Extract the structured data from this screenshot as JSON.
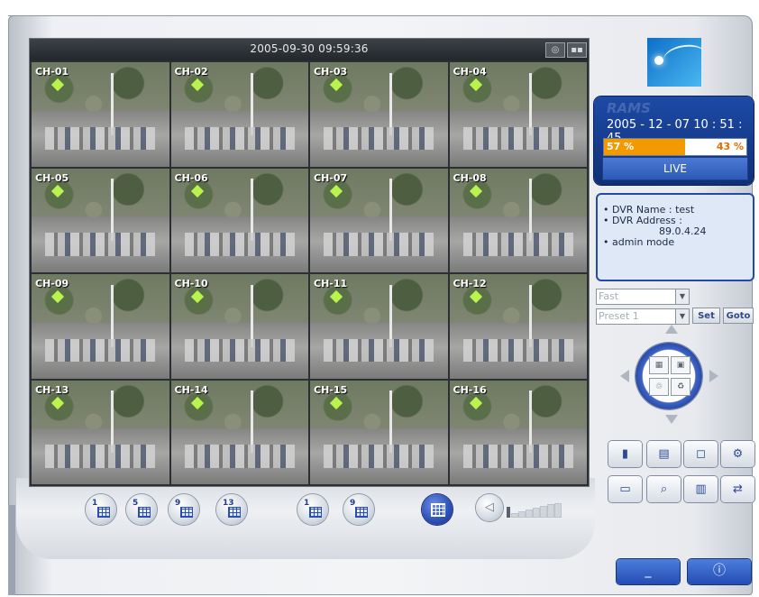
{
  "camera_view": {
    "datetime": "2005-09-30 09:59:36",
    "channels": [
      "CH-01",
      "CH-02",
      "CH-03",
      "CH-04",
      "CH-05",
      "CH-06",
      "CH-07",
      "CH-08",
      "CH-09",
      "CH-10",
      "CH-11",
      "CH-12",
      "CH-13",
      "CH-14",
      "CH-15",
      "CH-16"
    ]
  },
  "header_icons": [
    "camera-icon",
    "split-icon"
  ],
  "split_buttons": [
    {
      "number": "1",
      "icon": "single-grid-icon"
    },
    {
      "number": "5",
      "icon": "grid-icon"
    },
    {
      "number": "9",
      "icon": "grid-icon"
    },
    {
      "number": "13",
      "icon": "grid-icon"
    },
    {
      "number": "1",
      "icon": "grid-icon"
    },
    {
      "number": "9",
      "icon": "grid-icon"
    }
  ],
  "active_split": {
    "icon": "grid-16-icon"
  },
  "status": {
    "watermark": "RAMS",
    "datetime": "2005 - 12 - 07 10 : 51 : 45",
    "disk_used": "57 %",
    "disk_free": "43 %",
    "disk_used_fraction": 0.57,
    "mode": "LIVE"
  },
  "info": {
    "line1": "• DVR Name : test",
    "line2": "• DVR Address :",
    "line3": "89.0.4.24",
    "line4": "• admin mode"
  },
  "ptz": {
    "speed_value": "Fast",
    "preset_value": "Preset 1",
    "set_label": "Set",
    "goto_label": "Goto"
  },
  "tools_row1": [
    "record-icon",
    "export-icon",
    "fullscreen-icon",
    "settings-icon"
  ],
  "tools_row2": [
    "playback-icon",
    "search-icon",
    "backup-icon",
    "network-icon"
  ],
  "window_buttons": {
    "minimize": "_",
    "power": "ⓘ"
  },
  "colors": {
    "accent": "#2a4ba8",
    "disk_used": "#f39a00",
    "live_button": "#2d5ab7"
  }
}
